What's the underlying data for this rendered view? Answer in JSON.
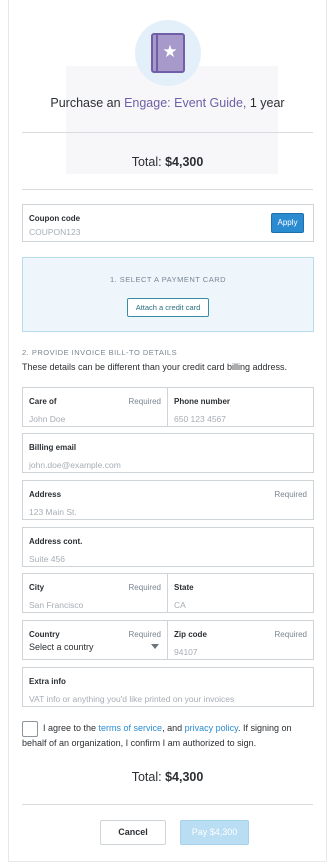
{
  "header": {
    "purchase_prefix": "Purchase an ",
    "product_name": "Engage: Event Guide,",
    "purchase_suffix": " 1 year",
    "icon": "book-star-icon"
  },
  "totals": {
    "label": "Total: ",
    "amount": "$4,300"
  },
  "coupon": {
    "label": "Coupon code",
    "placeholder": "COUPON123",
    "apply_label": "Apply"
  },
  "payment": {
    "step_label": "1. SELECT A PAYMENT CARD",
    "attach_label": "Attach a credit card"
  },
  "invoice": {
    "step_label": "2. PROVIDE INVOICE BILL-TO DETAILS",
    "subtitle": "These details can be different than your credit card billing address.",
    "required_text": "Required",
    "care_of": {
      "label": "Care of",
      "placeholder": "John Doe"
    },
    "phone": {
      "label": "Phone number",
      "placeholder": "650 123 4567"
    },
    "billing_email": {
      "label": "Billing email",
      "placeholder": "john.doe@example.com"
    },
    "address": {
      "label": "Address",
      "placeholder": "123 Main St."
    },
    "address_cont": {
      "label": "Address cont.",
      "placeholder": "Suite 456"
    },
    "city": {
      "label": "City",
      "placeholder": "San Francisco"
    },
    "state": {
      "label": "State",
      "placeholder": "CA"
    },
    "country": {
      "label": "Country",
      "value": "Select a country"
    },
    "zip": {
      "label": "Zip code",
      "placeholder": "94107"
    },
    "extra_info": {
      "label": "Extra info",
      "placeholder": "VAT info or anything you'd like printed on your invoices"
    }
  },
  "agreement": {
    "prefix": "I agree to the ",
    "terms_link": "terms of service",
    "middle": ", and ",
    "privacy_link": "privacy policy",
    "suffix": ". If signing on behalf of an organization, I confirm I am authorized to sign."
  },
  "actions": {
    "cancel_label": "Cancel",
    "pay_label": "Pay $4,300"
  }
}
